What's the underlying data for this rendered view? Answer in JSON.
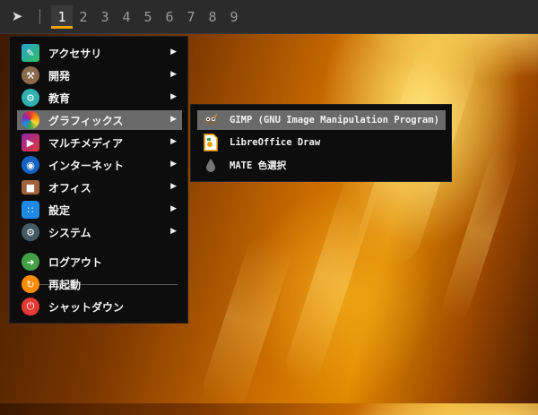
{
  "panel": {
    "launcher_icon": "send-icon",
    "workspaces": [
      "1",
      "2",
      "3",
      "4",
      "5",
      "6",
      "7",
      "8",
      "9"
    ],
    "active_workspace": "1",
    "accent": "#f0a000"
  },
  "menu": {
    "items": [
      {
        "label": "アクセサリ",
        "icon": "accessories-icon"
      },
      {
        "label": "開発",
        "icon": "development-icon"
      },
      {
        "label": "教育",
        "icon": "education-icon"
      },
      {
        "label": "グラフィックス",
        "icon": "graphics-icon"
      },
      {
        "label": "マルチメディア",
        "icon": "multimedia-icon"
      },
      {
        "label": "インターネット",
        "icon": "internet-icon"
      },
      {
        "label": "オフィス",
        "icon": "office-icon"
      },
      {
        "label": "設定",
        "icon": "settings-icon"
      },
      {
        "label": "システム",
        "icon": "system-icon"
      }
    ],
    "actions": [
      {
        "label": "ログアウト",
        "icon": "logout-icon"
      },
      {
        "label": "再起動",
        "icon": "restart-icon"
      },
      {
        "label": "シャットダウン",
        "icon": "shutdown-icon"
      }
    ],
    "arrow": "▶"
  },
  "submenu": {
    "items": [
      {
        "label": "GIMP (GNU Image Manipulation Program)",
        "icon": "gimp-icon"
      },
      {
        "label": "LibreOffice Draw",
        "icon": "libreoffice-draw-icon"
      },
      {
        "label": "MATE 色選択",
        "icon": "color-picker-icon"
      }
    ]
  }
}
